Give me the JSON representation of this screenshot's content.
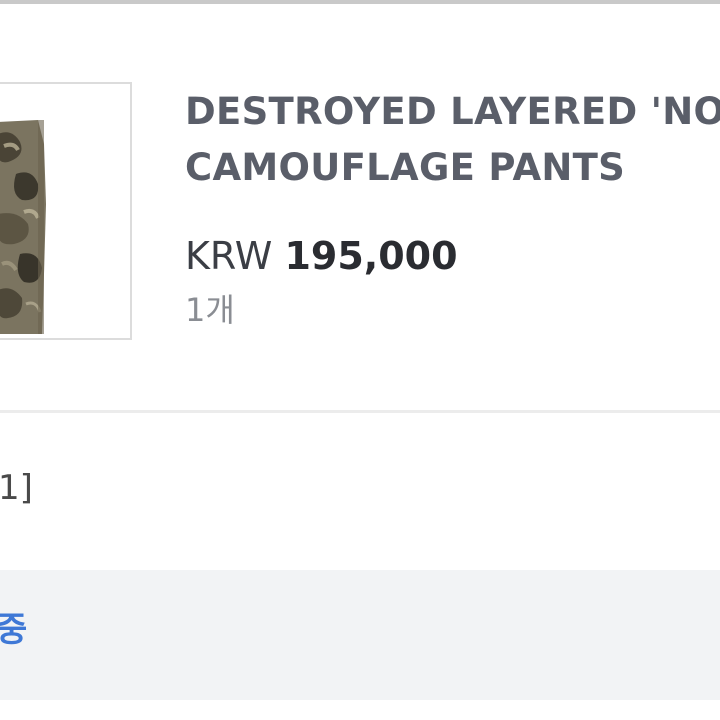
{
  "product": {
    "image_alt": "camouflage pants thumbnail",
    "name_line1": "DESTROYED LAYERED 'NO",
    "name_line2": "CAMOUFLAGE PANTS",
    "currency": "KRW",
    "price": "195,000",
    "quantity": "1개"
  },
  "option": {
    "text": "1]"
  },
  "status": {
    "text": "중",
    "color": "#3f78d6"
  }
}
